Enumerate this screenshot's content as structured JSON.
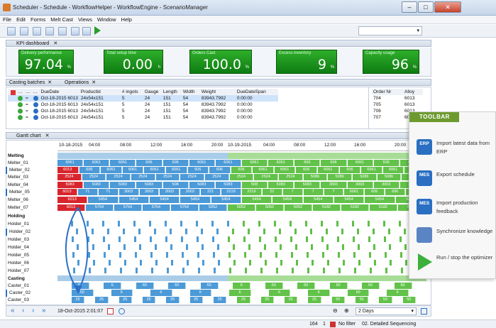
{
  "window": {
    "title": "Scheduler - Schedule - WorkflowHelper - WorkflowEngine - ScenarioManager"
  },
  "menu": [
    "File",
    "Edit",
    "Forms",
    "Melt Cast",
    "Views",
    "Window",
    "Help"
  ],
  "kpi": {
    "tab": "KPI dashboard",
    "tiles": [
      {
        "label": "Delivery performance",
        "value": "97.04",
        "unit": "%"
      },
      {
        "label": "Total setup time",
        "value": "0.00",
        "unit": "h"
      },
      {
        "label": "Orders Cast",
        "value": "100.0",
        "unit": "%"
      },
      {
        "label": "Excess inventory",
        "value": "9",
        "unit": "%"
      },
      {
        "label": "Capacity usage",
        "value": "96",
        "unit": "%"
      }
    ]
  },
  "casting": {
    "tab1": "Casting batches",
    "tab2": "Operations",
    "headers": [
      "DueDate",
      "ProductId",
      "# ingots",
      "Gauge",
      "Length",
      "Width",
      "Weight",
      "DueDateSpan"
    ],
    "rows": [
      [
        "Oct-18-2015 6013",
        "24x54x151",
        "5",
        "24",
        "151",
        "54",
        "83943.7992",
        "0:00:00"
      ],
      [
        "Oct-18-2015 6013",
        "24x54x151",
        "5",
        "24",
        "151",
        "54",
        "83943.7992",
        "0:00:00"
      ],
      [
        "Oct-18-2015 6013",
        "24x54x151",
        "5",
        "24",
        "151",
        "54",
        "83943.7992",
        "0:00:00"
      ],
      [
        "Oct-18-2015 6013",
        "24x54x151",
        "5",
        "24",
        "151",
        "54",
        "83943.7992",
        "0:00:00"
      ]
    ],
    "right_headers": [
      "Order Nr",
      "Alloy"
    ],
    "right_rows": [
      [
        "704",
        "6013"
      ],
      [
        "705",
        "6013"
      ],
      [
        "706",
        "6013"
      ],
      [
        "707",
        "6013"
      ]
    ]
  },
  "gantt": {
    "tab": "Gantt chart",
    "dates": [
      "10-18-2015",
      "04:00",
      "08:00",
      "12:00",
      "16:00",
      "20:00",
      "10-19-2015",
      "04:00",
      "08:00",
      "12:00",
      "16:00",
      "20:00"
    ],
    "groups": {
      "melting": "Melting",
      "holding": "Holding",
      "casting": "Casting"
    },
    "melters": [
      "Melter_01",
      "Melter_02",
      "Melter_03",
      "Melter_04",
      "Melter_05",
      "Melter_06",
      "Melter_07"
    ],
    "holders": [
      "Holder_01",
      "Holder_02",
      "Holder_03",
      "Holder_04",
      "Holder_05",
      "Holder_06",
      "Holder_07"
    ],
    "casters": [
      "Caster_01",
      "Caster_02",
      "Caster_03"
    ],
    "bar_labels": {
      "m1": [
        "6061",
        "6061",
        "6061",
        "606",
        "606",
        "6061",
        "6061",
        "6061",
        "6061",
        "606",
        "606",
        "6061",
        "606",
        "6061"
      ],
      "m2": [
        "6013",
        "606",
        "6061",
        "6061",
        "6061",
        "6061",
        "606",
        "606",
        "606",
        "6061",
        "6061",
        "606",
        "6061",
        "606",
        "6061",
        "6061",
        "5182"
      ],
      "m3": [
        "2524",
        "2524",
        "2524",
        "2524",
        "2524",
        "2524",
        "2524",
        "2524",
        "2524",
        "2524",
        "5086",
        "5086",
        "5086",
        "5086",
        "5086"
      ],
      "m4": [
        "5083",
        "5083",
        "5083",
        "5083",
        "508",
        "5083",
        "5083",
        "508",
        "5083",
        "5083",
        "3003",
        "3003",
        "3003",
        "3003"
      ],
      "m5": [
        "6013",
        "71",
        "71",
        "3003",
        "3003",
        "3003",
        "3003",
        "221",
        "2219",
        "2219",
        "22",
        "7",
        "7",
        "7",
        "6061",
        "606",
        "606",
        "6061"
      ],
      "m6": [
        "6013",
        "5454",
        "5454",
        "5454",
        "5454",
        "5454",
        "5454",
        "5454",
        "5454",
        "5454",
        "5454",
        "5454"
      ],
      "m7": [
        "6013",
        "5754",
        "5754",
        "5754",
        "5754",
        "5052",
        "5052",
        "5052",
        "5052",
        "5182",
        "5182",
        "5182",
        "5182"
      ],
      "c1": [
        "60",
        "6",
        "60",
        "60",
        "60",
        "6",
        "60",
        "60",
        "60",
        "60",
        "60"
      ],
      "c2": [
        "50",
        "6",
        "6",
        "6",
        "6",
        "6",
        "6",
        "50",
        "6"
      ],
      "c3": [
        "25",
        "25",
        "25",
        "25",
        "25",
        "25",
        "25",
        "25",
        "25",
        "25",
        "25",
        "50",
        "50",
        "50",
        "50"
      ]
    },
    "date_field": "18-Oct-2015 2:01:07",
    "zoom_select": "2 Days"
  },
  "toolbar_panel": {
    "title": "TOOLBAR",
    "items": [
      {
        "icon": "ERP",
        "label": "Import latest data from ERP"
      },
      {
        "icon": "MES",
        "label": "Export schedule"
      },
      {
        "icon": "MES",
        "label": "Import production feedback"
      },
      {
        "icon": "",
        "label": "Synchronize knowledge"
      },
      {
        "icon": "",
        "label": "Run / stop the optimizer"
      }
    ]
  },
  "status": {
    "count": "164",
    "page": "1",
    "filter": "No filter",
    "mode": "02. Detailed Sequencing"
  },
  "colors": {
    "melting_blue": "#4c9ad7",
    "melting_green": "#62c24a",
    "late_red": "#d8252d",
    "kpi_green": "#1a8e1c",
    "toolbar_green": "#6d9a2f"
  }
}
